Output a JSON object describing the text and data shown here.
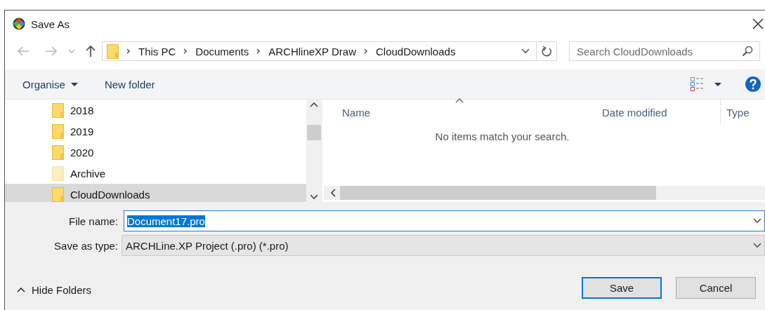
{
  "window": {
    "title": "Save As"
  },
  "address_bar": {
    "crumbs": [
      "This PC",
      "Documents",
      "ARCHlineXP Draw",
      "CloudDownloads"
    ]
  },
  "search": {
    "placeholder": "Search CloudDownloads"
  },
  "toolbar": {
    "organise": "Organise",
    "new_folder": "New folder"
  },
  "tree": {
    "items": [
      {
        "label": "2018",
        "hidden": false,
        "selected": false
      },
      {
        "label": "2019",
        "hidden": false,
        "selected": false
      },
      {
        "label": "2020",
        "hidden": false,
        "selected": false
      },
      {
        "label": "Archive",
        "hidden": true,
        "selected": false
      },
      {
        "label": "CloudDownloads",
        "hidden": false,
        "selected": true
      }
    ]
  },
  "file_list": {
    "columns": [
      {
        "label": "Name",
        "sorted": true
      },
      {
        "label": "Date modified",
        "sorted": false
      },
      {
        "label": "Type",
        "sorted": false
      }
    ],
    "empty_message": "No items match your search."
  },
  "file_name": {
    "label": "File name:",
    "value": "Document17.pro",
    "value_selected": true
  },
  "save_as_type": {
    "label": "Save as type:",
    "value": "ARCHLine.XP Project (.pro) (*.pro)"
  },
  "hide_folders": "Hide Folders",
  "buttons": [
    {
      "label": "Save",
      "default": true
    },
    {
      "label": "Cancel",
      "default": false
    }
  ]
}
